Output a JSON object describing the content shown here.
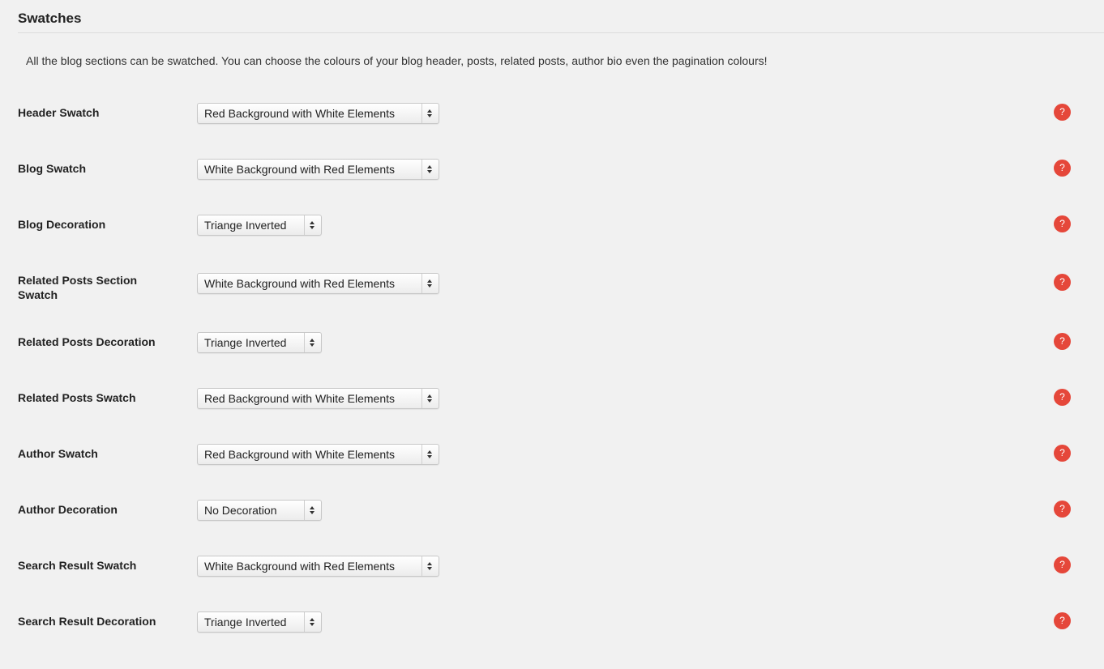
{
  "section": {
    "title": "Swatches",
    "description": "All the blog sections can be swatched. You can choose the colours of your blog header, posts, related posts, author bio even the pagination colours!"
  },
  "colors": {
    "background": "#f1f1f1",
    "help_icon": "#e5473a"
  },
  "help_glyph": "?",
  "rows": [
    {
      "label": "Header Swatch",
      "value": "Red Background with White Elements"
    },
    {
      "label": "Blog Swatch",
      "value": "White Background with Red Elements"
    },
    {
      "label": "Blog Decoration",
      "value": "Triange Inverted"
    },
    {
      "label": "Related Posts Section Swatch",
      "value": "White Background with Red Elements"
    },
    {
      "label": "Related Posts Decoration",
      "value": "Triange Inverted"
    },
    {
      "label": "Related Posts Swatch",
      "value": "Red Background with White Elements"
    },
    {
      "label": "Author Swatch",
      "value": "Red Background with White Elements"
    },
    {
      "label": "Author Decoration",
      "value": "No Decoration"
    },
    {
      "label": "Search Result Swatch",
      "value": "White Background with Red Elements"
    },
    {
      "label": "Search Result Decoration",
      "value": "Triange Inverted"
    }
  ]
}
